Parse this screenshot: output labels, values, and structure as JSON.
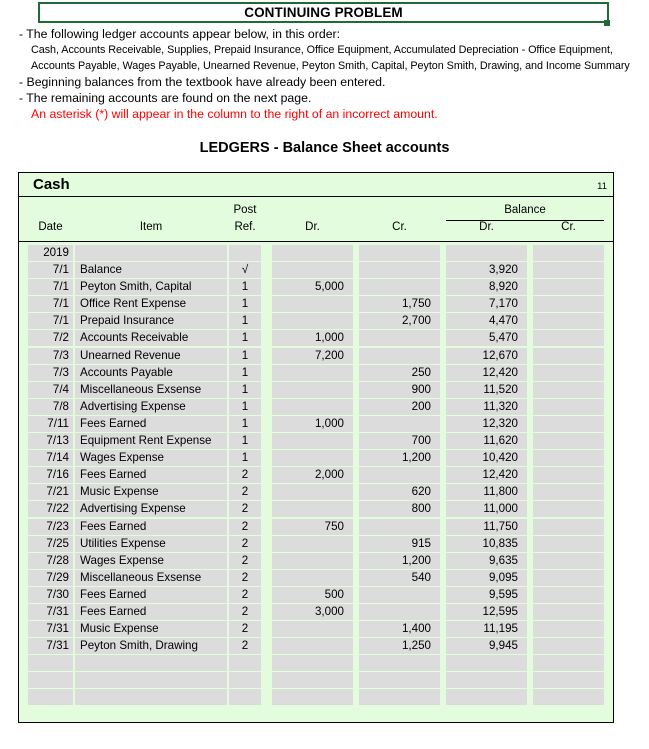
{
  "header": {
    "title": "CONTINUING PROBLEM"
  },
  "intro": {
    "line1": "-  The following ledger accounts appear below, in this order:",
    "line2": "Cash, Accounts Receivable, Supplies, Prepaid Insurance, Office Equipment, Accumulated Depreciation - Office Equipment,",
    "line3": "Accounts Payable, Wages Payable, Unearned Revenue, Peyton Smith, Capital, Peyton Smith, Drawing, and Income Summary",
    "line4": "- Beginning balances from the textbook have already been entered.",
    "line5": "- The remaining accounts are found on the next page.",
    "line6": "An asterisk (*) will appear in the column to the right of an incorrect amount.",
    "red_color": "#FF0000"
  },
  "section_heading": "LEDGERS - Balance Sheet accounts",
  "ledger": {
    "account_name": "Cash",
    "account_number": "11",
    "colors": {
      "background": "#E3FCDD",
      "cell": "#DCDCDC",
      "border": "#000000",
      "title_border": "#1F6B38"
    },
    "columns": {
      "date": "Date",
      "item": "Item",
      "post": "Post",
      "ref": "Ref.",
      "dr": "Dr.",
      "cr": "Cr.",
      "balance": "Balance",
      "balance_dr": "Dr.",
      "balance_cr": "Cr."
    },
    "rows": [
      {
        "date": "2019",
        "item": "",
        "ref": "",
        "dr": "",
        "cr": "",
        "bal_dr": "",
        "bal_cr": ""
      },
      {
        "date": "7/1",
        "item": "Balance",
        "ref": "√",
        "dr": "",
        "cr": "",
        "bal_dr": "3,920",
        "bal_cr": ""
      },
      {
        "date": "7/1",
        "item": "Peyton Smith, Capital",
        "ref": "1",
        "dr": "5,000",
        "cr": "",
        "bal_dr": "8,920",
        "bal_cr": ""
      },
      {
        "date": "7/1",
        "item": "Office Rent Expense",
        "ref": "1",
        "dr": "",
        "cr": "1,750",
        "bal_dr": "7,170",
        "bal_cr": ""
      },
      {
        "date": "7/1",
        "item": "Prepaid Insurance",
        "ref": "1",
        "dr": "",
        "cr": "2,700",
        "bal_dr": "4,470",
        "bal_cr": ""
      },
      {
        "date": "7/2",
        "item": "Accounts Receivable",
        "ref": "1",
        "dr": "1,000",
        "cr": "",
        "bal_dr": "5,470",
        "bal_cr": ""
      },
      {
        "date": "7/3",
        "item": "Unearned Revenue",
        "ref": "1",
        "dr": "7,200",
        "cr": "",
        "bal_dr": "12,670",
        "bal_cr": ""
      },
      {
        "date": "7/3",
        "item": "Accounts Payable",
        "ref": "1",
        "dr": "",
        "cr": "250",
        "bal_dr": "12,420",
        "bal_cr": ""
      },
      {
        "date": "7/4",
        "item": "Miscellaneous Exsense",
        "ref": "1",
        "dr": "",
        "cr": "900",
        "bal_dr": "11,520",
        "bal_cr": ""
      },
      {
        "date": "7/8",
        "item": "Advertising Expense",
        "ref": "1",
        "dr": "",
        "cr": "200",
        "bal_dr": "11,320",
        "bal_cr": ""
      },
      {
        "date": "7/11",
        "item": "Fees Earned",
        "ref": "1",
        "dr": "1,000",
        "cr": "",
        "bal_dr": "12,320",
        "bal_cr": ""
      },
      {
        "date": "7/13",
        "item": "Equipment Rent Expense",
        "ref": "1",
        "dr": "",
        "cr": "700",
        "bal_dr": "11,620",
        "bal_cr": ""
      },
      {
        "date": "7/14",
        "item": "Wages Expense",
        "ref": "1",
        "dr": "",
        "cr": "1,200",
        "bal_dr": "10,420",
        "bal_cr": ""
      },
      {
        "date": "7/16",
        "item": "Fees Earned",
        "ref": "2",
        "dr": "2,000",
        "cr": "",
        "bal_dr": "12,420",
        "bal_cr": ""
      },
      {
        "date": "7/21",
        "item": "Music Expense",
        "ref": "2",
        "dr": "",
        "cr": "620",
        "bal_dr": "11,800",
        "bal_cr": ""
      },
      {
        "date": "7/22",
        "item": "Advertising Expense",
        "ref": "2",
        "dr": "",
        "cr": "800",
        "bal_dr": "11,000",
        "bal_cr": ""
      },
      {
        "date": "7/23",
        "item": "Fees Earned",
        "ref": "2",
        "dr": "750",
        "cr": "",
        "bal_dr": "11,750",
        "bal_cr": ""
      },
      {
        "date": "7/25",
        "item": "Utilities Expense",
        "ref": "2",
        "dr": "",
        "cr": "915",
        "bal_dr": "10,835",
        "bal_cr": ""
      },
      {
        "date": "7/28",
        "item": "Wages Expense",
        "ref": "2",
        "dr": "",
        "cr": "1,200",
        "bal_dr": "9,635",
        "bal_cr": ""
      },
      {
        "date": "7/29",
        "item": "Miscellaneous Exsense",
        "ref": "2",
        "dr": "",
        "cr": "540",
        "bal_dr": "9,095",
        "bal_cr": ""
      },
      {
        "date": "7/30",
        "item": "Fees Earned",
        "ref": "2",
        "dr": "500",
        "cr": "",
        "bal_dr": "9,595",
        "bal_cr": ""
      },
      {
        "date": "7/31",
        "item": "Fees Earned",
        "ref": "2",
        "dr": "3,000",
        "cr": "",
        "bal_dr": "12,595",
        "bal_cr": ""
      },
      {
        "date": "7/31",
        "item": "Music Expense",
        "ref": "2",
        "dr": "",
        "cr": "1,400",
        "bal_dr": "11,195",
        "bal_cr": ""
      },
      {
        "date": "7/31",
        "item": "Peyton Smith, Drawing",
        "ref": "2",
        "dr": "",
        "cr": "1,250",
        "bal_dr": "9,945",
        "bal_cr": ""
      },
      {
        "date": "",
        "item": "",
        "ref": "",
        "dr": "",
        "cr": "",
        "bal_dr": "",
        "bal_cr": ""
      },
      {
        "date": "",
        "item": "",
        "ref": "",
        "dr": "",
        "cr": "",
        "bal_dr": "",
        "bal_cr": ""
      },
      {
        "date": "",
        "item": "",
        "ref": "",
        "dr": "",
        "cr": "",
        "bal_dr": "",
        "bal_cr": ""
      }
    ]
  }
}
